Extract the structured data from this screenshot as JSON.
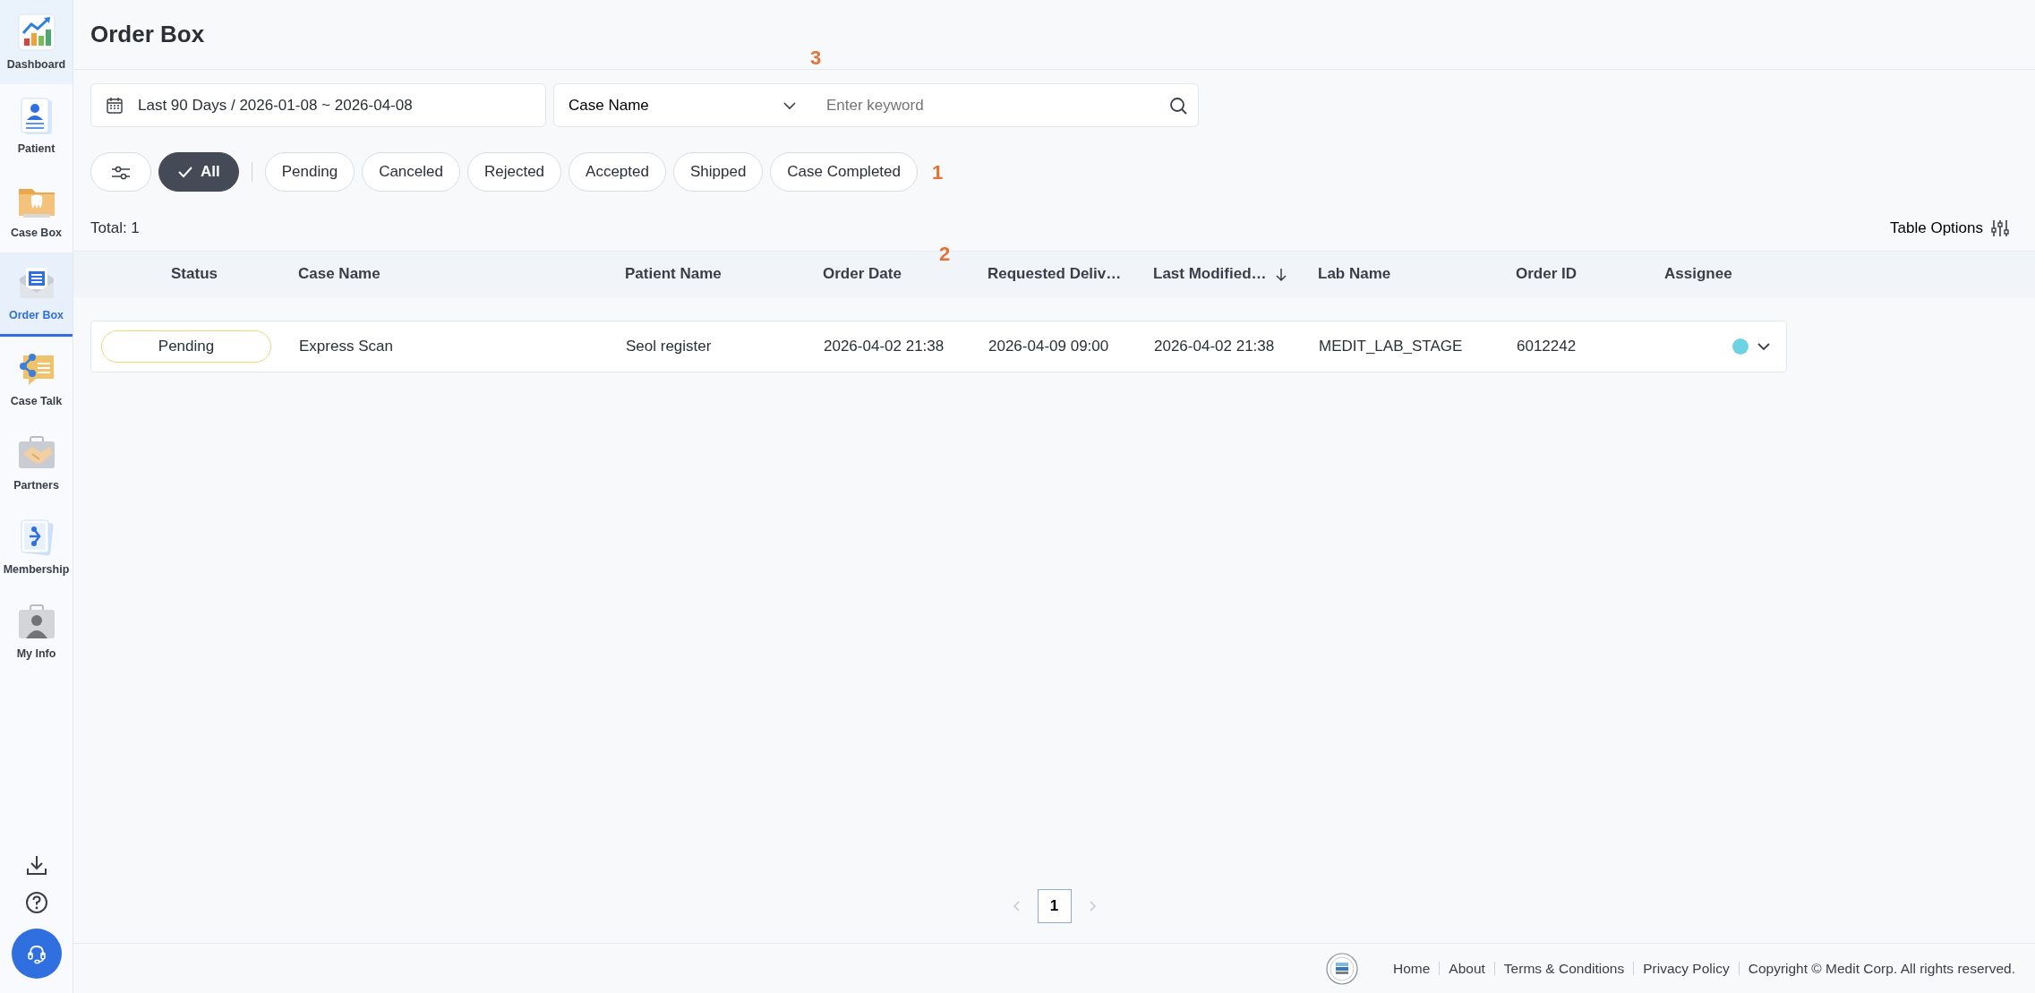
{
  "sidebar": {
    "items": [
      {
        "label": "Dashboard",
        "selected": false,
        "hovered": true
      },
      {
        "label": "Patient",
        "selected": false,
        "hovered": false
      },
      {
        "label": "Case Box",
        "selected": false,
        "hovered": false
      },
      {
        "label": "Order Box",
        "selected": true,
        "hovered": false
      },
      {
        "label": "Case Talk",
        "selected": false,
        "hovered": false
      },
      {
        "label": "Partners",
        "selected": false,
        "hovered": false
      },
      {
        "label": "Membership",
        "selected": false,
        "hovered": false
      },
      {
        "label": "My Info",
        "selected": false,
        "hovered": false
      }
    ]
  },
  "page_title": "Order Box",
  "search": {
    "date_range": "Last 90 Days / 2026-01-08 ~ 2026-04-08",
    "field_select": "Case Name",
    "placeholder": "Enter keyword",
    "marker": "3"
  },
  "status_filters": {
    "marker": "1",
    "chips": [
      {
        "label": "All",
        "selected": true
      },
      {
        "label": "Pending",
        "selected": false
      },
      {
        "label": "Canceled",
        "selected": false
      },
      {
        "label": "Rejected",
        "selected": false
      },
      {
        "label": "Accepted",
        "selected": false
      },
      {
        "label": "Shipped",
        "selected": false
      },
      {
        "label": "Case Completed",
        "selected": false
      }
    ]
  },
  "total": "Total: 1",
  "table_options": "Table Options",
  "table": {
    "marker": "2",
    "columns": [
      {
        "label": "Status",
        "sorted": false
      },
      {
        "label": "Case Name",
        "sorted": false
      },
      {
        "label": "Patient Name",
        "sorted": false
      },
      {
        "label": "Order Date",
        "sorted": false
      },
      {
        "label": "Requested Deliv…",
        "sorted": false
      },
      {
        "label": "Last Modified…",
        "sorted": true
      },
      {
        "label": "Lab Name",
        "sorted": false
      },
      {
        "label": "Order ID",
        "sorted": false
      },
      {
        "label": "Assignee",
        "sorted": false
      }
    ],
    "rows": [
      {
        "status": {
          "label": "Pending",
          "color": "#f0d77e"
        },
        "case_name": "Express Scan",
        "patient_name": "Seol register",
        "order_date": "2026-04-02 21:38",
        "requested_delivery": "2026-04-09 09:00",
        "last_modified": "2026-04-02 21:38",
        "lab_name": "MEDIT_LAB_STAGE",
        "order_id": "6012242",
        "assignee": {
          "color": "#6dd3e3"
        }
      }
    ]
  },
  "pagination": {
    "pages": [
      {
        "label": "1",
        "selected": true
      }
    ]
  },
  "footer": {
    "links": [
      "Home",
      "About",
      "Terms & Conditions",
      "Privacy Policy"
    ],
    "copyright": "Copyright © Medit Corp. All rights reserved."
  }
}
